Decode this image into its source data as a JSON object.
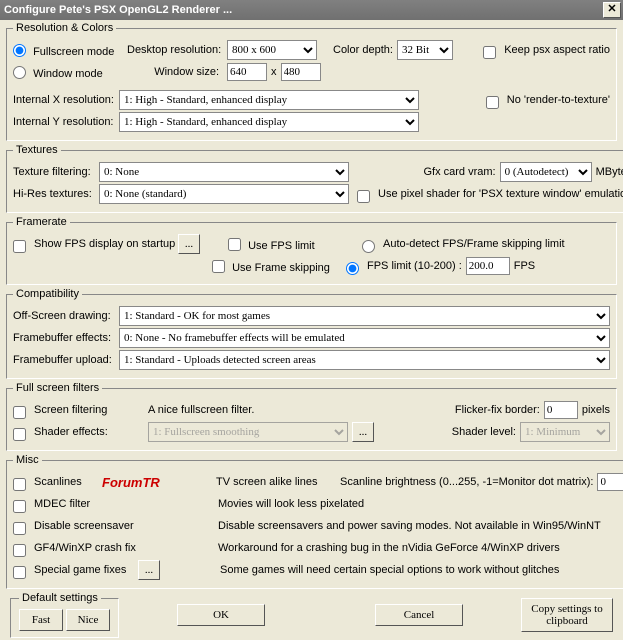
{
  "title": "Configure Pete's PSX OpenGL2 Renderer ...",
  "resolution": {
    "legend": "Resolution & Colors",
    "fullscreen": "Fullscreen mode",
    "window": "Window mode",
    "desktop_res_label": "Desktop resolution:",
    "desktop_res": "800 x 600",
    "color_depth_label": "Color depth:",
    "color_depth": "32 Bit",
    "window_size_label": "Window size:",
    "win_w": "640",
    "win_x": "x",
    "win_h": "480",
    "keep_aspect": "Keep psx aspect ratio",
    "internal_x_label": "Internal X resolution:",
    "internal_x": "1: High - Standard, enhanced display",
    "internal_y_label": "Internal Y resolution:",
    "internal_y": "1: High - Standard, enhanced display",
    "no_rtt": "No 'render-to-texture'"
  },
  "textures": {
    "legend": "Textures",
    "filtering_label": "Texture filtering:",
    "filtering": "0: None",
    "hires_label": "Hi-Res textures:",
    "hires": "0: None (standard)",
    "vram_label": "Gfx card vram:",
    "vram": "0 (Autodetect)",
    "mbytes": "MBytes",
    "pixel_shader": "Use pixel shader for 'PSX texture window' emulation"
  },
  "framerate": {
    "legend": "Framerate",
    "show_fps": "Show FPS display on startup",
    "use_limit": "Use FPS limit",
    "use_frameskip": "Use Frame skipping",
    "autodetect": "Auto-detect FPS/Frame skipping limit",
    "fps_limit_label": "FPS limit (10-200) :",
    "fps_limit": "200.0",
    "fps": "FPS"
  },
  "compat": {
    "legend": "Compatibility",
    "offscreen_label": "Off-Screen drawing:",
    "offscreen": "1: Standard - OK for most games",
    "fbeffects_label": "Framebuffer effects:",
    "fbeffects": "0: None - No framebuffer effects will be emulated",
    "fbupload_label": "Framebuffer upload:",
    "fbupload": "1: Standard - Uploads detected screen areas"
  },
  "filters": {
    "legend": "Full screen filters",
    "screen_filtering": "Screen filtering",
    "screen_filtering_desc": "A nice fullscreen filter.",
    "flicker_label": "Flicker-fix border:",
    "flicker": "0",
    "pixels": "pixels",
    "shader_effects": "Shader effects:",
    "shader_value": "1: Fullscreen smoothing",
    "shader_level_label": "Shader level:",
    "shader_level": "1: Minimum"
  },
  "misc": {
    "legend": "Misc",
    "watermark": "ForumTR",
    "scanlines": "Scanlines",
    "scanlines_desc": "TV screen alike lines",
    "scan_bright_label": "Scanline brightness (0...255, -1=Monitor dot matrix):",
    "scan_bright": "0",
    "mdec": "MDEC filter",
    "mdec_desc": "Movies will look less pixelated",
    "screensaver": "Disable screensaver",
    "screensaver_desc": "Disable screensavers and power saving modes. Not available in Win95/WinNT",
    "gf4": "GF4/WinXP crash fix",
    "gf4_desc": "Workaround for a crashing bug in the nVidia GeForce 4/WinXP drivers",
    "special": "Special game fixes",
    "special_desc": "Some games will need certain special options to work without glitches"
  },
  "defaults": {
    "legend": "Default settings",
    "fast": "Fast",
    "nice": "Nice"
  },
  "buttons": {
    "ok": "OK",
    "cancel": "Cancel",
    "copy": "Copy settings to clipboard",
    "dots": "..."
  }
}
